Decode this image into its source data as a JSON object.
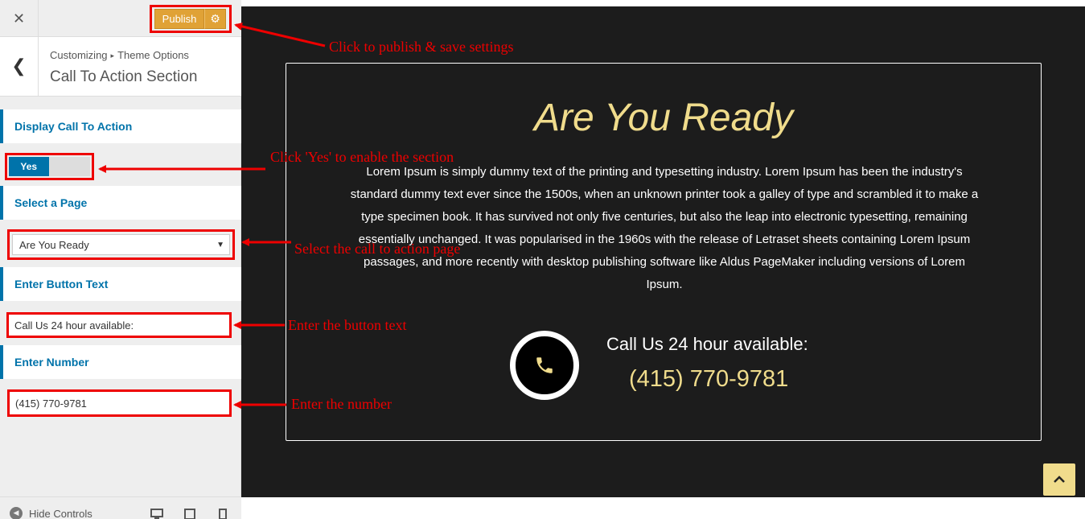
{
  "topbar": {
    "close_glyph": "✕",
    "publish_label": "Publish",
    "publish_gear_glyph": "⚙"
  },
  "section_header": {
    "back_glyph": "❮",
    "breadcrumb_root": "Customizing",
    "breadcrumb_sep": "▸",
    "breadcrumb_current": "Theme Options",
    "title": "Call To Action Section"
  },
  "controls": {
    "display_label": "Display Call To Action",
    "toggle_yes": "Yes",
    "select_page_label": "Select a Page",
    "selected_page": "Are You Ready",
    "button_text_label": "Enter Button Text",
    "button_text_value": "Call Us 24 hour available:",
    "number_label": "Enter Number",
    "number_value": "(415) 770-9781"
  },
  "footer": {
    "hide_controls": "Hide Controls",
    "icons": [
      "desktop-icon",
      "tablet-icon",
      "mobile-icon"
    ]
  },
  "preview": {
    "title": "Are You Ready",
    "body_lines": [
      "Lorem Ipsum is simply dummy text of the printing and typesetting industry. Lorem Ipsum has been the industry's",
      "standard dummy text ever since the 1500s, when an unknown printer took a galley of type and scrambled it to make a",
      "type specimen book. It has survived not only five centuries, but also the leap into electronic typesetting, remaining",
      "essentially unchanged. It was popularised in the 1960s with the release of Letraset sheets containing Lorem Ipsum",
      "passages, and more recently with desktop publishing software like Aldus PageMaker including versions of Lorem",
      "Ipsum."
    ],
    "call_text": "Call Us 24 hour available:",
    "call_number": "(415) 770-9781"
  },
  "annotations": {
    "publish": "Click to publish & save settings",
    "enable": "Click 'Yes' to enable the section",
    "select_page": "Select the call to action page",
    "button_text": "Enter the button text",
    "number": "Enter the number"
  },
  "colors": {
    "accent_blue": "#0073aa",
    "publish_orange": "#e0a236",
    "preview_bg": "#1c1c1c",
    "gold": "#f0dc8c",
    "annotation_red": "#ee0000"
  }
}
